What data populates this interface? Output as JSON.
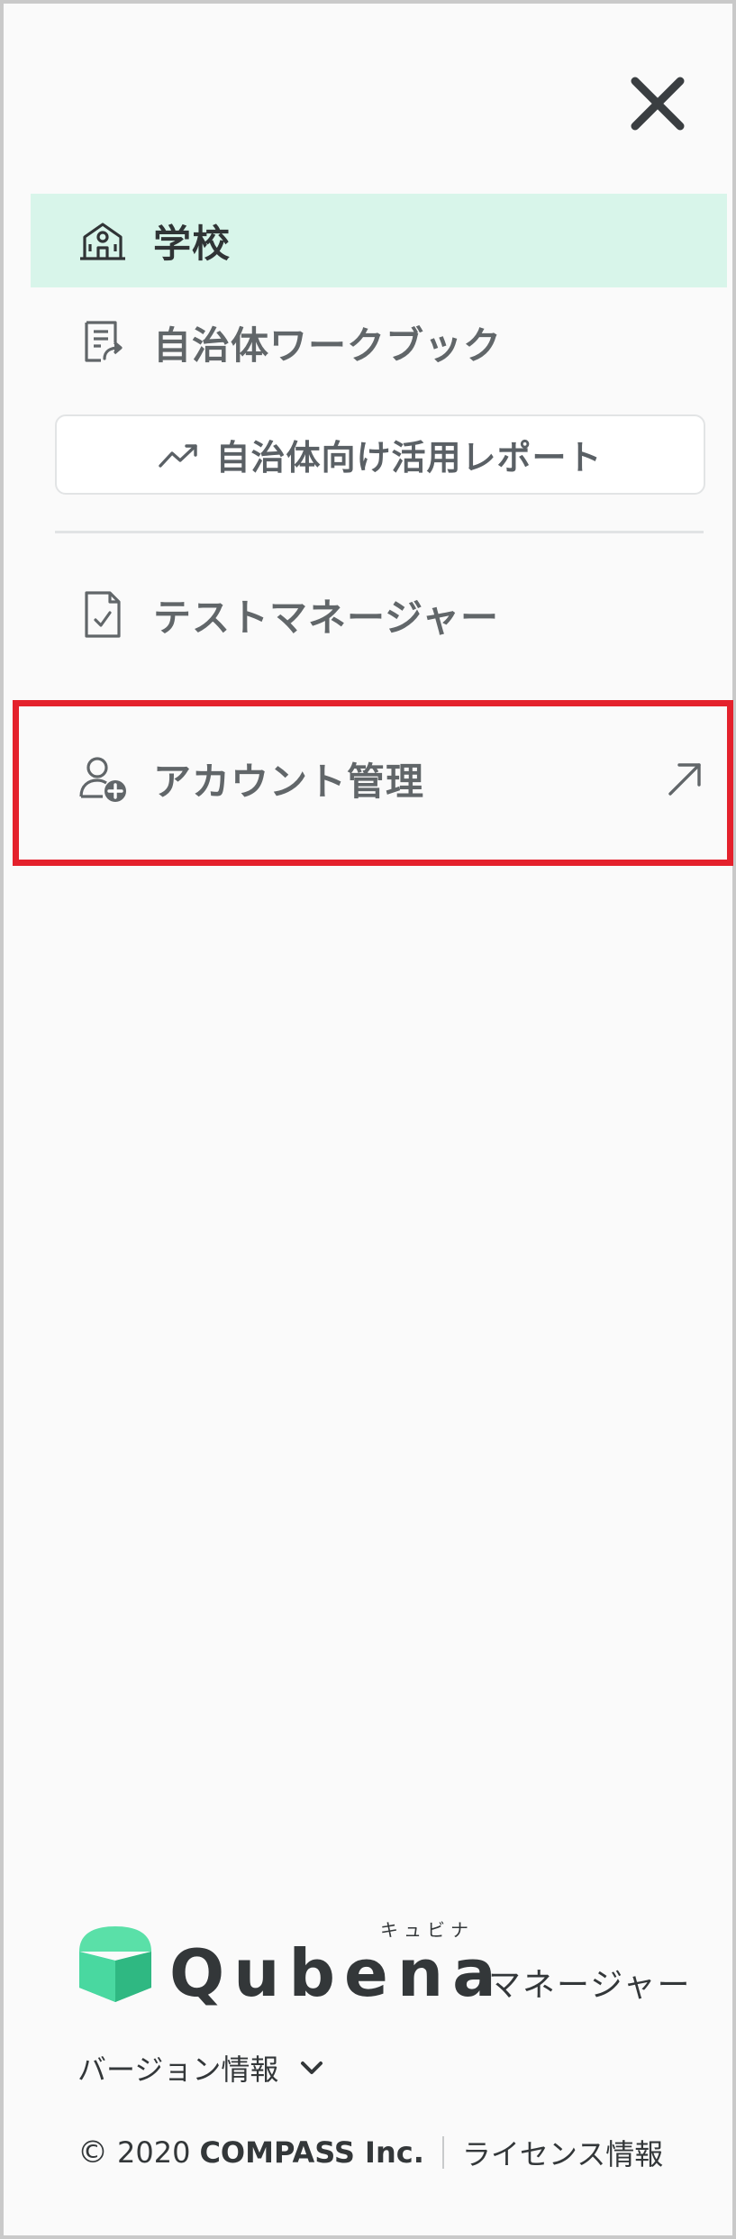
{
  "menu": {
    "close_icon": "close-icon",
    "items": [
      {
        "label": "学校",
        "icon": "school-icon",
        "active": true
      },
      {
        "label": "自治体ワークブック",
        "icon": "workbook-icon",
        "active": false
      }
    ],
    "report_button": {
      "label": "自治体向け活用レポート",
      "icon": "trending-up-icon"
    },
    "test_manager": {
      "label": "テストマネージャー",
      "icon": "document-check-icon"
    },
    "account": {
      "label": "アカウント管理",
      "icon": "user-add-icon",
      "trailing_icon": "external-arrow-icon"
    }
  },
  "brand": {
    "wordmark": "Qubena",
    "ruby": "キュビナ",
    "suffix": "マネージャー",
    "logo_color": "#3ecf96"
  },
  "footer": {
    "version_label": "バージョン情報",
    "copyright_symbol": "©",
    "year": "2020",
    "company": "COMPASS Inc.",
    "license_label": "ライセンス情報"
  },
  "colors": {
    "active_bg": "#d8f5ea",
    "highlight": "#e4212c",
    "text_muted": "#616669",
    "text_dark": "#303436"
  }
}
